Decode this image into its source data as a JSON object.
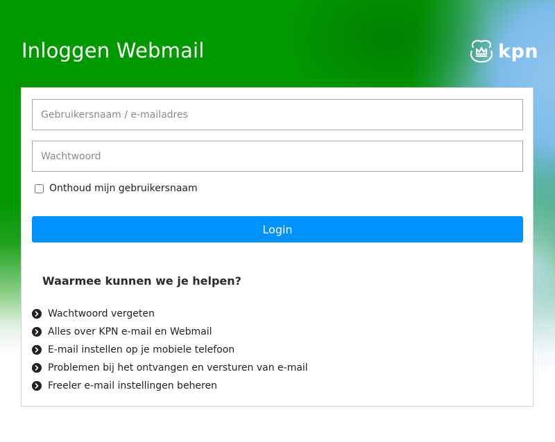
{
  "header": {
    "title": "Inloggen Webmail",
    "logo_text": "kpn"
  },
  "form": {
    "username_placeholder": "Gebruikersnaam / e-mailadres",
    "username_value": "",
    "password_placeholder": "Wachtwoord",
    "password_value": "",
    "remember_label": "Onthoud mijn gebruikersnaam",
    "remember_checked": false,
    "login_label": "Login"
  },
  "help": {
    "title": "Waarmee kunnen we je helpen?",
    "links": [
      {
        "label": "Wachtwoord vergeten"
      },
      {
        "label": "Alles over KPN e-mail en Webmail"
      },
      {
        "label": "E-mail instellen op je mobiele telefoon"
      },
      {
        "label": "Problemen bij het ontvangen en versturen van e-mail"
      },
      {
        "label": "Freeler e-mail instellingen beheren"
      }
    ],
    "bullet_icon": "chevron-right-circle-icon"
  },
  "colors": {
    "brand_green": "#009900",
    "login_button": "#0092ff",
    "accent_blue": "#7cbcea"
  }
}
